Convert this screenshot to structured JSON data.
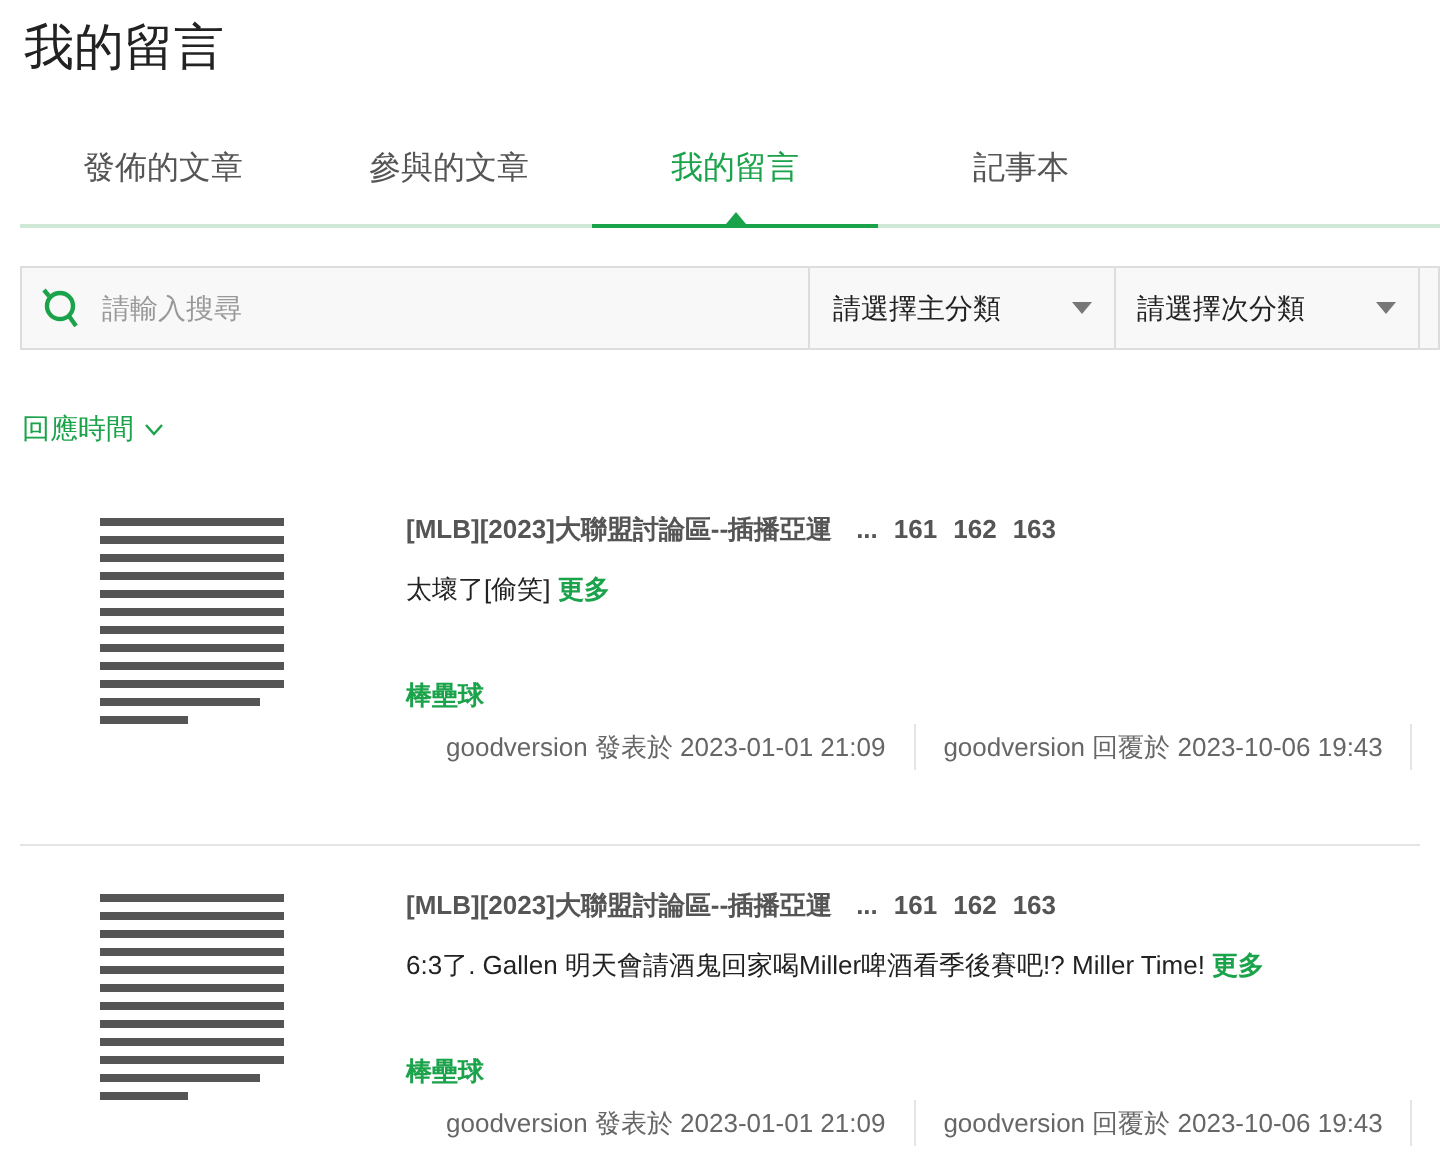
{
  "page_title": "我的留言",
  "tabs": [
    {
      "label": "發佈的文章",
      "selected": false
    },
    {
      "label": "參與的文章",
      "selected": false
    },
    {
      "label": "我的留言",
      "selected": true
    },
    {
      "label": "記事本",
      "selected": false
    }
  ],
  "search": {
    "placeholder": "請輸入搜尋"
  },
  "filters": [
    "請選擇主分類",
    "請選擇次分類"
  ],
  "sort": {
    "label": "回應時間"
  },
  "comments": [
    {
      "thread": "[MLB][2023]大聯盟討論區--插播亞運",
      "ellipsis": "...",
      "pages": [
        "161",
        "162",
        "163"
      ],
      "text": "太壞了[偷笑]",
      "more": "更多",
      "category": "棒壘球",
      "posted": "goodversion 發表於 2023-01-01 21:09",
      "replied": "goodversion 回覆於 2023-10-06 19:43"
    },
    {
      "thread": "[MLB][2023]大聯盟討論區--插播亞運",
      "ellipsis": "...",
      "pages": [
        "161",
        "162",
        "163"
      ],
      "text": "6:3了. Gallen 明天會請酒鬼回家喝Miller啤酒看季後賽吧!? Miller Time!",
      "more": "更多",
      "category": "棒壘球",
      "posted": "goodversion 發表於 2023-01-01 21:09",
      "replied": "goodversion 回覆於 2023-10-06 19:43"
    }
  ]
}
